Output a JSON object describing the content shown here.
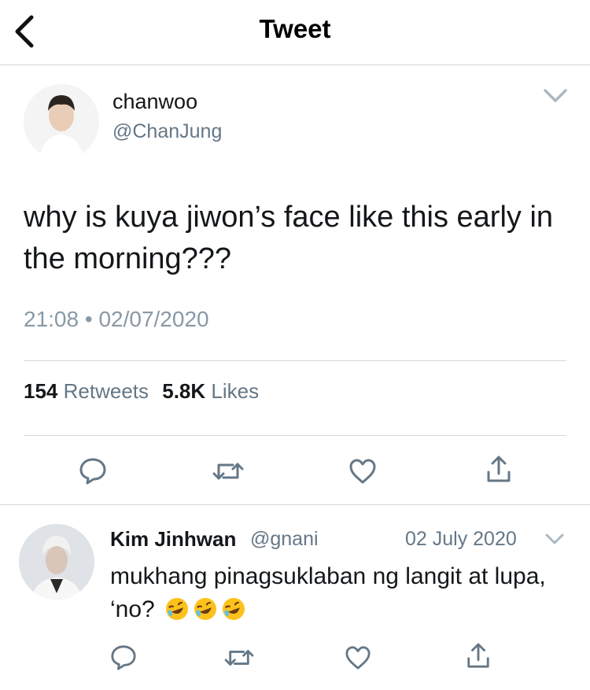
{
  "header": {
    "title": "Tweet"
  },
  "tweet": {
    "author_name": "chanwoo",
    "author_handle": "@ChanJung",
    "text": "why is kuya jiwon’s face like this early in the morning???",
    "time": "21:08",
    "separator": "•",
    "date": "02/07/2020",
    "retweets_count": "154",
    "retweets_label": "Retweets",
    "likes_count": "5.8K",
    "likes_label": "Likes"
  },
  "reply": {
    "author_name": "Kim Jinhwan",
    "author_handle": "@gnani",
    "date": "02 July 2020",
    "text": "mukhang pinagsuklaban ng langit at lupa, ‘no?",
    "emojis": [
      "🤣",
      "🤣",
      "🤣"
    ]
  },
  "icons": [
    "back-arrow-icon",
    "chevron-down-icon",
    "reply-icon",
    "retweet-icon",
    "like-icon",
    "share-icon"
  ],
  "colors": {
    "text": "#14171a",
    "secondary": "#657786",
    "meta": "#8899a6",
    "divider": "#d3d8dc",
    "icon": "#657786"
  }
}
